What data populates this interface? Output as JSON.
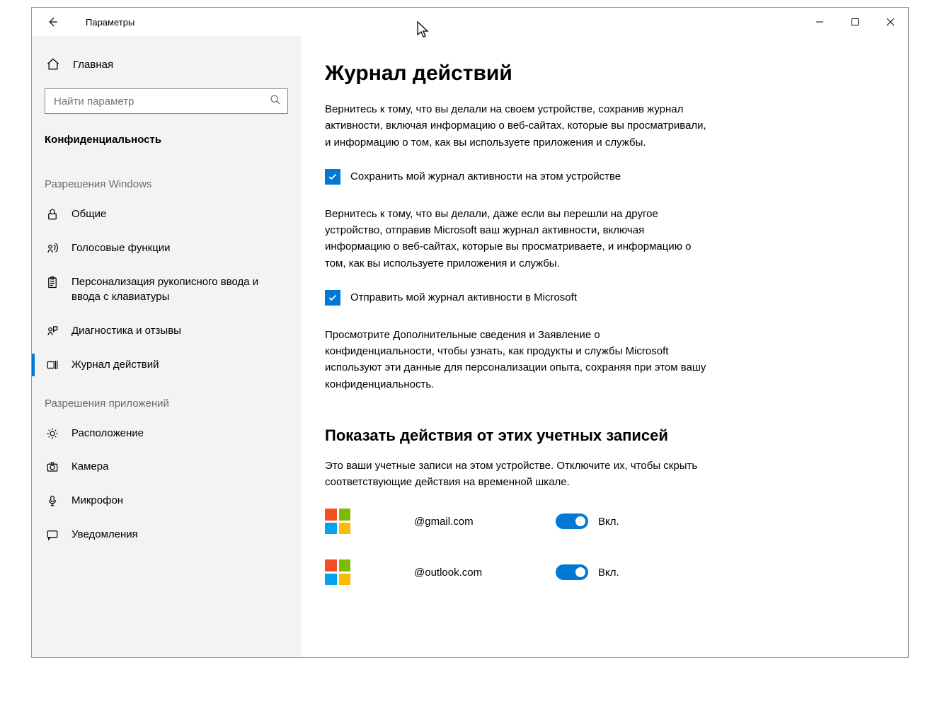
{
  "window": {
    "title": "Параметры"
  },
  "sidebar": {
    "home": "Главная",
    "search_placeholder": "Найти параметр",
    "current": "Конфиденциальность",
    "section1": "Разрешения Windows",
    "section2": "Разрешения приложений",
    "items1": [
      {
        "label": "Общие"
      },
      {
        "label": "Голосовые функции"
      },
      {
        "label": "Персонализация рукописного ввода и ввода с клавиатуры"
      },
      {
        "label": "Диагностика и отзывы"
      },
      {
        "label": "Журнал действий"
      }
    ],
    "items2": [
      {
        "label": "Расположение"
      },
      {
        "label": "Камера"
      },
      {
        "label": "Микрофон"
      },
      {
        "label": "Уведомления"
      }
    ]
  },
  "main": {
    "h1": "Журнал действий",
    "p1": "Вернитесь к тому, что вы делали на своем устройстве, сохранив журнал активности, включая информацию о веб-сайтах, которые вы просматривали, и информацию о том, как вы используете приложения и службы.",
    "check1": "Сохранить мой журнал активности на этом устройстве",
    "p2": "Вернитесь к тому, что вы делали, даже если вы перешли на другое устройство, отправив Microsoft ваш журнал активности, включая информацию о веб-сайтах, которые вы просматриваете, и информацию о том, как вы используете приложения и службы.",
    "check2": "Отправить мой журнал активности в Microsoft",
    "p3": "Просмотрите Дополнительные сведения и Заявление о конфиденциальности, чтобы узнать, как продукты и службы Microsoft используют эти данные для персонализации опыта, сохраняя при этом вашу конфиденциальность.",
    "h2": "Показать действия от этих учетных записей",
    "p4": "Это ваши учетные записи на этом устройстве. Отключите их, чтобы скрыть соответствующие действия на временной шкале.",
    "accounts": [
      {
        "email": "@gmail.com",
        "state": "Вкл."
      },
      {
        "email": "@outlook.com",
        "state": "Вкл."
      }
    ]
  }
}
